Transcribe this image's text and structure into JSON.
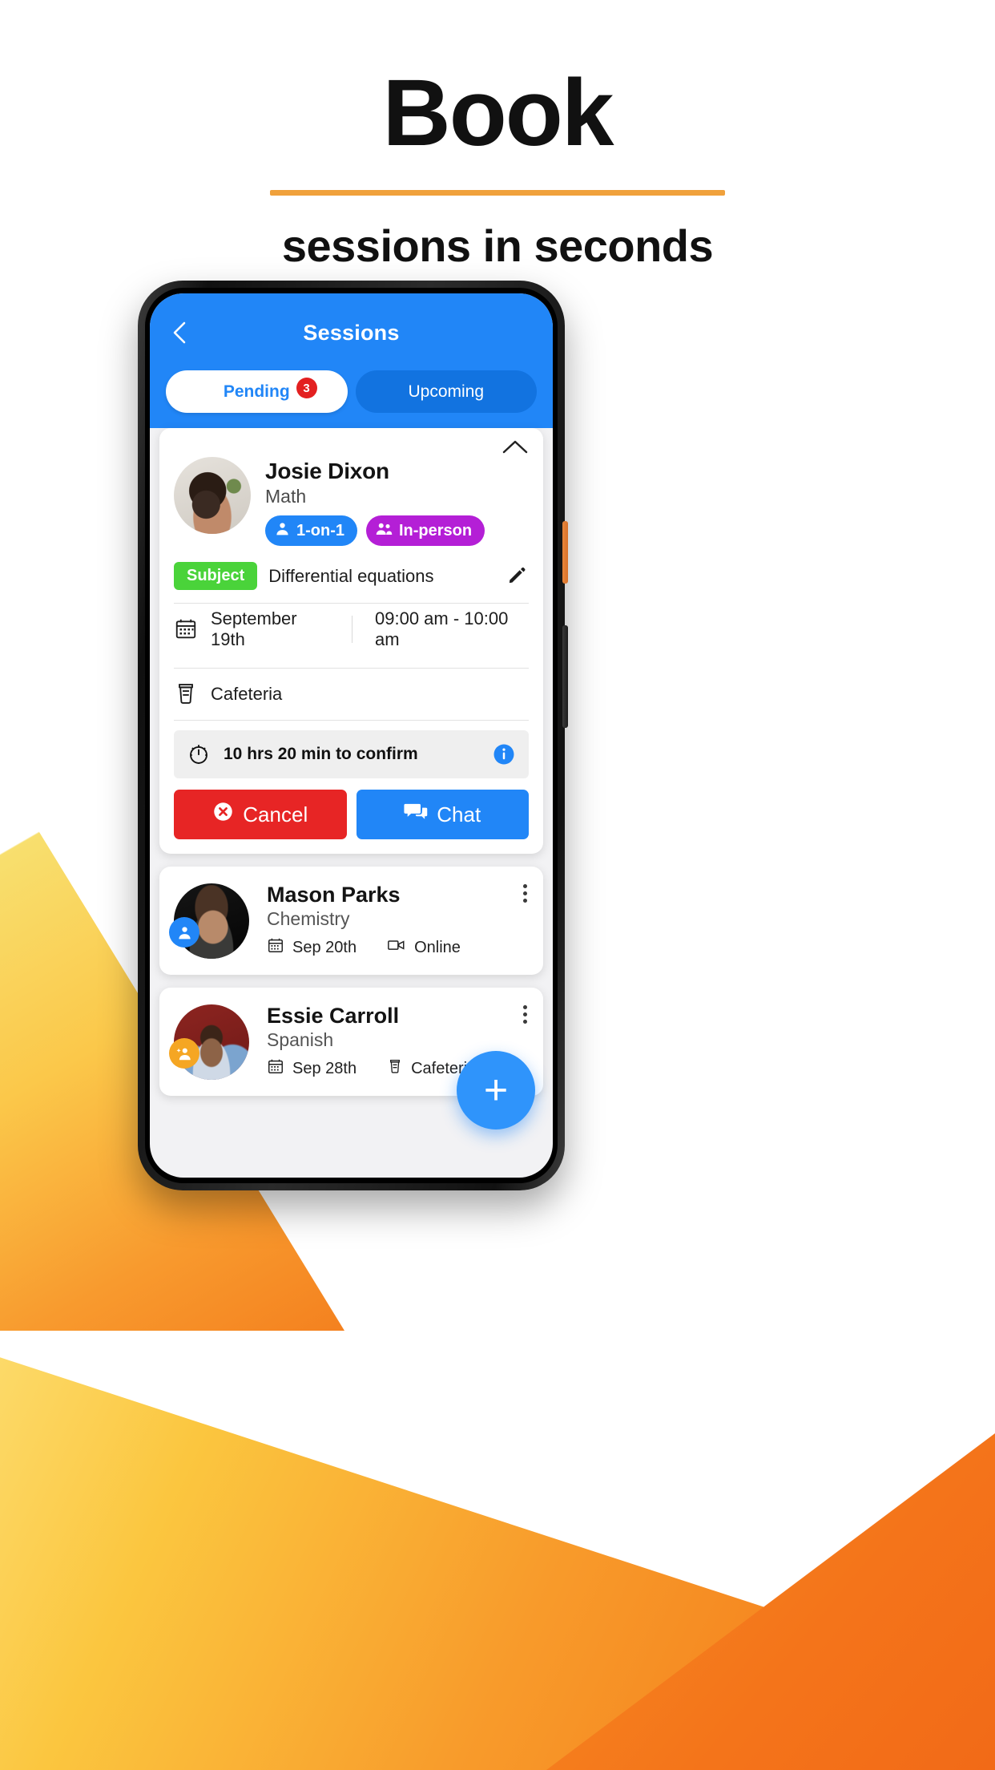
{
  "promo": {
    "headline": "Book",
    "subheadline": "sessions in seconds",
    "rule_color": "#f0a13c"
  },
  "app": {
    "header": {
      "title": "Sessions",
      "back_icon": "chevron-left-icon",
      "accent_color": "#2186f7"
    },
    "tabs": [
      {
        "label": "Pending",
        "active": true,
        "badge": "3"
      },
      {
        "label": "Upcoming",
        "active": false,
        "badge": ""
      }
    ],
    "expanded_card": {
      "collapse_icon": "chevron-up-icon",
      "avatar_icon": "avatar-photo",
      "name": "Josie Dixon",
      "subject_area": "Math",
      "chips": [
        {
          "label": "1-on-1",
          "icon": "person-icon",
          "color": "#2186f7"
        },
        {
          "label": "In-person",
          "icon": "people-icon",
          "color": "#b41fd6"
        }
      ],
      "subject_tag": "Subject",
      "subject_value": "Differential equations",
      "edit_icon": "pencil-icon",
      "date_icon": "calendar-icon",
      "date": "September 19th",
      "time": "09:00 am - 10:00 am",
      "location_icon": "coffee-cup-icon",
      "location": "Cafeteria",
      "confirm_icon": "stopwatch-icon",
      "confirm_text": "10 hrs 20 min to confirm",
      "info_icon": "info-icon",
      "buttons": [
        {
          "label": "Cancel",
          "icon": "cancel-circle-icon",
          "color": "#e72525"
        },
        {
          "label": "Chat",
          "icon": "chat-bubbles-icon",
          "color": "#2186f7"
        }
      ]
    },
    "compact_cards": [
      {
        "name": "Mason Parks",
        "subject": "Chemistry",
        "badge_icon": "person-icon",
        "badge_color": "#2186f7",
        "date_icon": "calendar-icon",
        "date": "Sep 20th",
        "mode_icon": "video-camera-icon",
        "mode": "Online",
        "menu_icon": "kebab-menu-icon"
      },
      {
        "name": "Essie Carroll",
        "subject": "Spanish",
        "badge_icon": "person-add-icon",
        "badge_color": "#f5a623",
        "date_icon": "calendar-icon",
        "date": "Sep 28th",
        "mode_icon": "coffee-cup-icon",
        "mode": "Cafeteria",
        "menu_icon": "kebab-menu-icon"
      }
    ],
    "fab": {
      "icon": "plus-icon",
      "label": "+",
      "color": "#2f94fb"
    }
  }
}
